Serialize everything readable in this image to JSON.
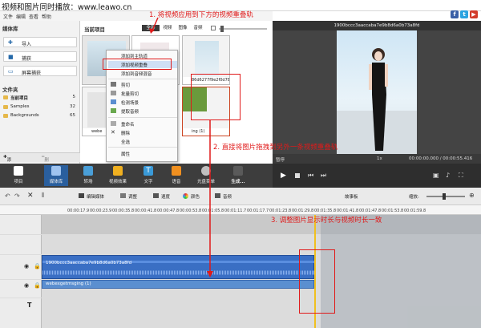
{
  "window": {
    "title": "视频和图片同时播放：www.leawo.cn"
  },
  "menu": [
    "文件",
    "编辑",
    "查看",
    "帮助"
  ],
  "left_panel": {
    "media_title": "媒体库",
    "buttons": [
      "导入",
      "捕获",
      "屏幕捕获"
    ],
    "folders_title": "文件夹",
    "folders": [
      {
        "name": "当前项目",
        "count": "5"
      },
      {
        "name": "Samples",
        "count": "32"
      },
      {
        "name": "Backgrounds",
        "count": "65"
      }
    ],
    "add_folder": "添加文件夹",
    "delete_folder": "删除文件夹"
  },
  "media": {
    "title": "当前项目",
    "tabs": [
      "全部",
      "视频",
      "图像",
      "音频"
    ],
    "items": [
      {
        "caption": ""
      },
      {
        "caption": ""
      },
      {
        "caption": "86d6277f9e2f0d78..."
      },
      {
        "caption": "webe"
      },
      {
        "caption": "ing (1)"
      }
    ]
  },
  "context_menu": {
    "items": [
      "添加到主轨道",
      "添加视频重叠",
      "添加到音频混音",
      "剪切",
      "批量剪切",
      "检测场景",
      "提取音频",
      "重命名",
      "删除",
      "全选",
      "属性"
    ]
  },
  "preview": {
    "title": "1900bccc3aaccaba7e9b8d6a0b73a8fd",
    "state": "暂停",
    "speed": "1x",
    "time": "00:00:00.000 / 00:00:55.416"
  },
  "toolbar": {
    "items": [
      "项目",
      "媒体库",
      "转场",
      "视频效果",
      "文字",
      "语音",
      "光盘菜单",
      "生成..."
    ]
  },
  "timeline_toolbar": {
    "items": [
      "编辑媒体",
      "调整",
      "速度",
      "颜色",
      "音频"
    ],
    "storyboard": "故事板",
    "zoom_label": "缩放:"
  },
  "ruler": {
    "ticks": [
      "00:00:17.9",
      "00:00:23.9",
      "00:00:35.8",
      "00:00:41.8",
      "00:00:47.8",
      "00:00:53.8",
      "00:01:05.8",
      "00:01:11.7",
      "00:01:17.7",
      "00:01:23.8",
      "00:01:29.8",
      "00:01:35.8",
      "00:01:41.8",
      "00:01:47.8",
      "00:01:53.8",
      "00:01:59.8"
    ]
  },
  "tracks": {
    "video_clip": "1900bccc3aaccaba7e9b8d6a0b73a8fd",
    "overlay_clip": "webexgetmsging (1)"
  },
  "annotations": {
    "step1": "1. 将视频应用到下方的视频重叠轨",
    "step2": "2. 直接将图片拖拽到另外一条视频重叠轨",
    "step3": "3. 调整图片显示时长与视频时长一致"
  },
  "colors": {
    "accent": "#e01a1a",
    "track_blue": "#3a6fc4",
    "toolbar_bg": "#3d3d3d"
  }
}
